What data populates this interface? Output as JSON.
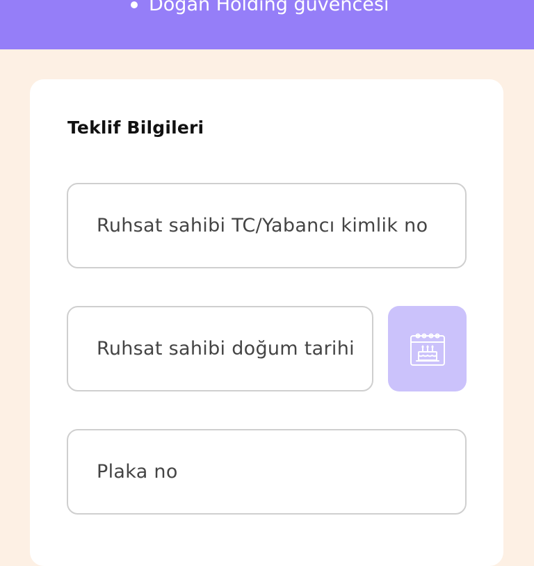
{
  "header": {
    "bullet_text": "Doğan Holding güvencesi"
  },
  "form": {
    "section_title": "Teklif Bilgileri",
    "tc_placeholder": "Ruhsat sahibi TC/Yabancı kimlik no",
    "dob_placeholder": "Ruhsat sahibi doğum tarihi",
    "plate_placeholder": "Plaka no"
  },
  "icons": {
    "date_picker": "birthday-calendar-icon"
  },
  "colors": {
    "header_bg": "#957ef8",
    "page_bg": "#fdf0e4",
    "card_bg": "#ffffff",
    "calendar_button_bg": "#cbc2fb",
    "field_border": "#cfcfcf"
  }
}
